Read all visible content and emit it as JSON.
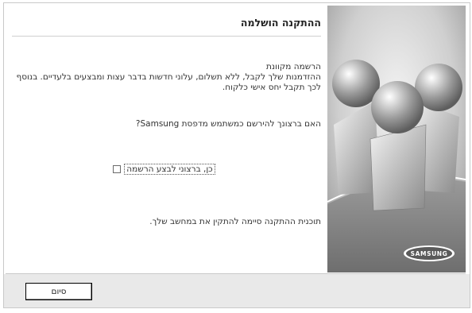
{
  "dialog": {
    "title": "ההתקנה הושלמה",
    "registration_text": "הרשמה מקוונת\nההזדמנות שלך לקבל, ללא תשלום, עלוני חדשות בדבר עצות ומבצעים בלעדיים. בנוסף לכך תקבל יחס אישי כלקוח.",
    "question": "האם ברצונך להירשם כמשתמש מדפסת Samsung?",
    "checkbox_label": "כן, ברצוני לבצע הרשמה",
    "checkbox_checked": false,
    "finish_text": "תוכנית ההתקנה סיימה להתקין את במחשב שלך.",
    "finish_button": "סיום"
  },
  "brand": {
    "logo_text": "SAMSUNG",
    "accent_blue": "#1a4ea0"
  }
}
